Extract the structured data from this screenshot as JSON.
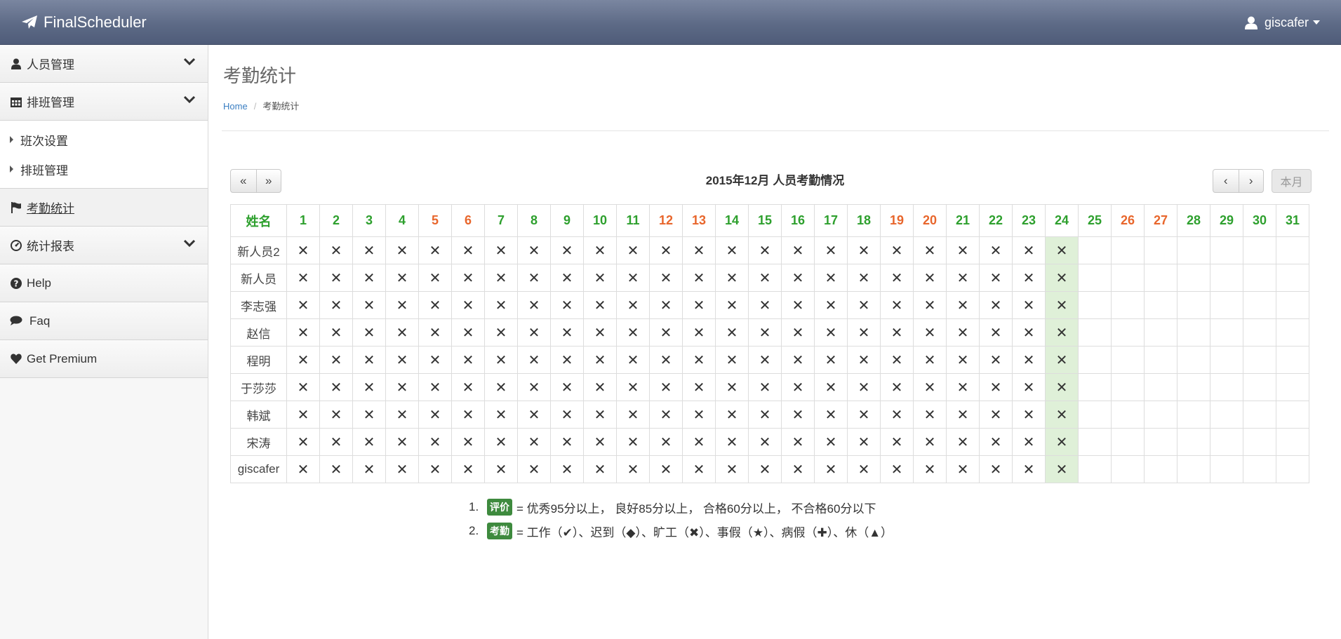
{
  "app": {
    "brand": "FinalScheduler",
    "user": "giscafer"
  },
  "sidebar": {
    "people": "人员管理",
    "shift": "排班管理",
    "sub_items": [
      "班次设置",
      "排班管理"
    ],
    "attendance": "考勤统计",
    "reports": "统计报表",
    "help": "Help",
    "faq": "Faq",
    "premium": "Get Premium"
  },
  "page": {
    "title": "考勤统计",
    "breadcrumb_home": "Home",
    "breadcrumb_current": "考勤统计"
  },
  "calendar": {
    "heading": "2015年12月 人员考勤情况",
    "prev_year": "«",
    "next_year": "»",
    "prev_month": "‹",
    "next_month": "›",
    "today_button": "本月",
    "name_header": "姓名",
    "today": 24,
    "weekend_days": [
      5,
      6,
      12,
      13,
      19,
      20,
      26,
      27
    ],
    "days": [
      1,
      2,
      3,
      4,
      5,
      6,
      7,
      8,
      9,
      10,
      11,
      12,
      13,
      14,
      15,
      16,
      17,
      18,
      19,
      20,
      21,
      22,
      23,
      24,
      25,
      26,
      27,
      28,
      29,
      30,
      31
    ],
    "recorded_days": 24,
    "mark": "✕",
    "rows": [
      "新人员2",
      "新人员",
      "李志强",
      "赵信",
      "程明",
      "于莎莎",
      "韩斌",
      "宋涛",
      "giscafer"
    ]
  },
  "legend": [
    {
      "num": "1.",
      "badge": "评价",
      "text": "= 优秀95分以上， 良好85分以上， 合格60分以上， 不合格60分以下"
    },
    {
      "num": "2.",
      "badge": "考勤",
      "text": "= 工作（✔）、迟到（◆）、旷工（✖）、事假（★）、病假（✚）、休（▲）"
    }
  ],
  "colors": {
    "workday": "#2ea02e",
    "weekend": "#e8662c",
    "today_bg": "#dff0d8",
    "badge": "#3e8a3e"
  }
}
